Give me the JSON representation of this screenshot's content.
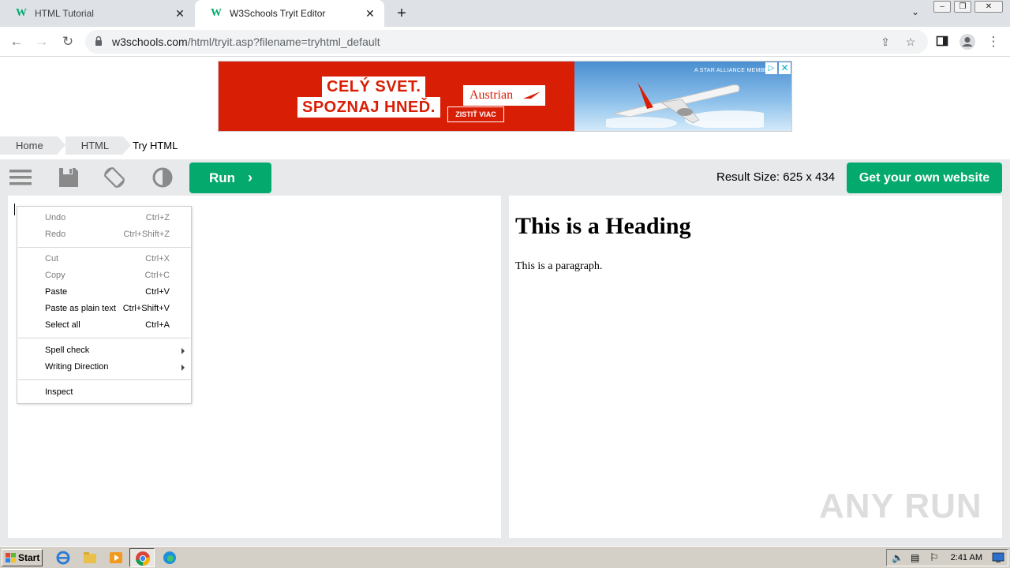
{
  "browser": {
    "tabs": [
      {
        "title": "HTML Tutorial",
        "favicon": "w3schools-icon",
        "active": false
      },
      {
        "title": "W3Schools Tryit Editor",
        "favicon": "w3schools-icon",
        "active": true
      }
    ],
    "url_host": "w3schools.com",
    "url_path": "/html/tryit.asp?filename=tryhtml_default"
  },
  "ad": {
    "line1": "CELÝ SVET.",
    "line2": "SPOZNAJ HNEĎ.",
    "brand": "Austrian",
    "cta": "ZISTIŤ VIAC",
    "alliance": "A STAR ALLIANCE MEMBER",
    "red": "#d81e05"
  },
  "breadcrumb": [
    "Home",
    "HTML",
    "Try HTML"
  ],
  "editor": {
    "run_label": "Run",
    "result_size": "Result Size: 625 x 434",
    "get_site_label": "Get your own website",
    "accent": "#04aa6d"
  },
  "result": {
    "heading": "This is a Heading",
    "paragraph": "This is a paragraph."
  },
  "context_menu": {
    "items": [
      {
        "label": "Undo",
        "shortcut": "Ctrl+Z",
        "disabled": true
      },
      {
        "label": "Redo",
        "shortcut": "Ctrl+Shift+Z",
        "disabled": true
      },
      {
        "label": "Cut",
        "shortcut": "Ctrl+X",
        "disabled": true
      },
      {
        "label": "Copy",
        "shortcut": "Ctrl+C",
        "disabled": true
      },
      {
        "label": "Paste",
        "shortcut": "Ctrl+V",
        "disabled": false
      },
      {
        "label": "Paste as plain text",
        "shortcut": "Ctrl+Shift+V",
        "disabled": false
      },
      {
        "label": "Select all",
        "shortcut": "Ctrl+A",
        "disabled": false
      },
      {
        "label": "Spell check",
        "shortcut": "",
        "disabled": false
      },
      {
        "label": "Writing Direction",
        "shortcut": "",
        "disabled": false
      },
      {
        "label": "Inspect",
        "shortcut": "",
        "disabled": false
      }
    ]
  },
  "watermark": "ANY RUN",
  "taskbar": {
    "start_label": "Start",
    "clock": "2:41 AM"
  }
}
